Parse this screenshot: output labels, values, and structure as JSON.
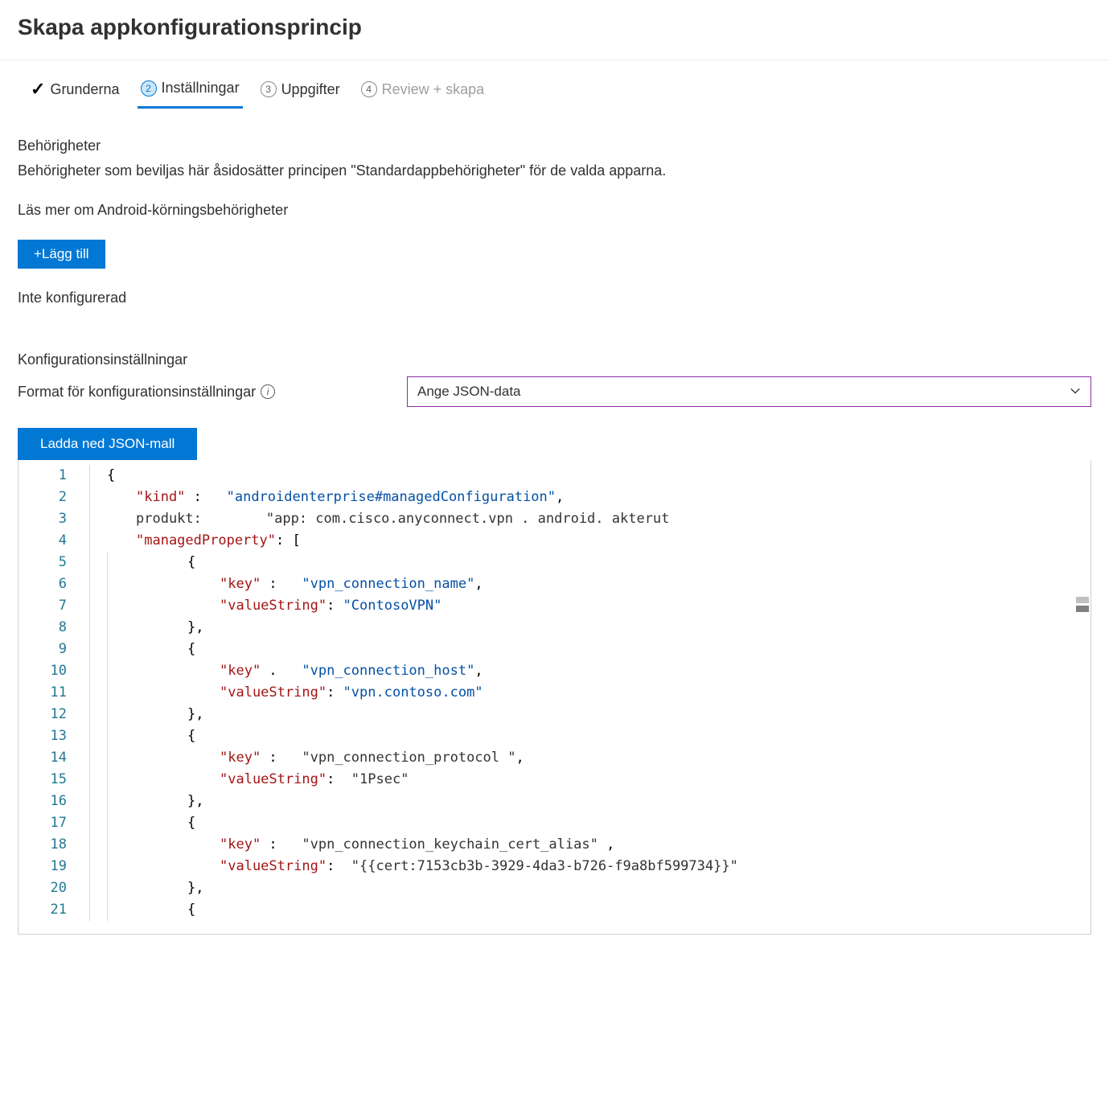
{
  "title": "Skapa appkonfigurationsprincip",
  "tabs": {
    "t1": "Grunderna",
    "t2_num": "2",
    "t2": "Inställningar",
    "t3_num": "3",
    "t3": "Uppgifter",
    "t4_num": "4",
    "t4": "Review + skapa"
  },
  "perm": {
    "title": "Behörigheter",
    "desc": "Behörigheter som beviljas här åsidosätter principen \"Standardappbehörigheter\" för de valda apparna.",
    "link": "Läs mer om Android-körningsbehörigheter",
    "add_btn": "+Lägg till",
    "not_conf": "Inte konfigurerad"
  },
  "conf": {
    "title": "Konfigurationsinställningar",
    "format_label": "Format för konfigurationsinställningar",
    "format_value": "Ange JSON-data",
    "download_btn": "Ladda ned JSON-mall"
  },
  "code": {
    "line_numbers": [
      "1",
      "2",
      "3",
      "4",
      "5",
      "6",
      "7",
      "8",
      "9",
      "10",
      "11",
      "12",
      "13",
      "14",
      "15",
      "16",
      "17",
      "18",
      "19",
      "20",
      "21"
    ],
    "l1_open": "{",
    "l2_k": "\"kind\"",
    "l2_c": " :   ",
    "l2_v": "\"androidenterprise#managedConfiguration\"",
    "l2_e": ",",
    "l3_k": "produkt:",
    "l3_v": "\"app: com.cisco.anyconnect.vpn . android. akterut",
    "l4_k": "\"managedProperty\"",
    "l4_c": ": [",
    "l5": "{",
    "l6_k": "\"key\"",
    "l6_c": " :   ",
    "l6_v": "\"vpn_connection_name\"",
    "l6_e": ",",
    "l7_k": "\"valueString\"",
    "l7_c": ": ",
    "l7_v": "\"ContosoVPN\"",
    "l8": "},",
    "l9": "{",
    "l10_k": "\"key\"",
    "l10_c": " .   ",
    "l10_v": "\"vpn_connection_host\"",
    "l10_e": ",",
    "l11_k": "\"valueString\"",
    "l11_c": ": ",
    "l11_v": "\"vpn.contoso.com\"",
    "l12": "},",
    "l13": "{",
    "l14_k": "\"key\"",
    "l14_c": " :   ",
    "l14_v": "\"vpn_connection_protocol \"",
    "l14_e": ",",
    "l15_k": "\"valueString\"",
    "l15_c": ":  ",
    "l15_v": "\"1Psec\"",
    "l16": "},",
    "l17": "{",
    "l18_k": "\"key\"",
    "l18_c": " :   ",
    "l18_v": "\"vpn_connection_keychain_cert_alias\"",
    "l18_e": " ,",
    "l19_k": "\"valueString\"",
    "l19_c": ":  ",
    "l19_v": "\"{{cert:7153cb3b-3929-4da3-b726-f9a8bf599734}}\"",
    "l20": "},",
    "l21": "{"
  }
}
